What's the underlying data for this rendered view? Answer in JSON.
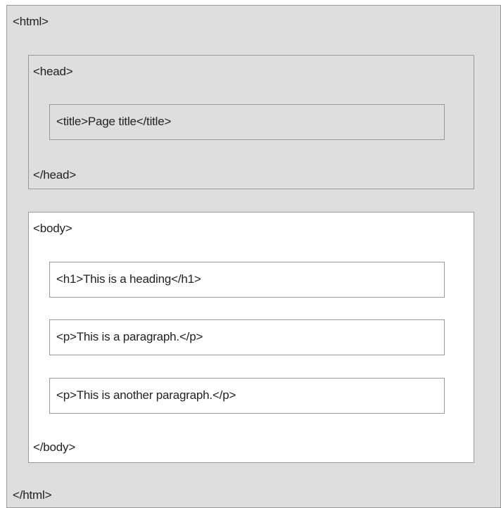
{
  "html": {
    "open_tag": "<html>",
    "close_tag": "</html>",
    "head": {
      "open_tag": "<head>",
      "close_tag": "</head>",
      "title_element": "<title>Page title</title>"
    },
    "body": {
      "open_tag": "<body>",
      "close_tag": "</body>",
      "children": [
        "<h1>This is a heading</h1>",
        "<p>This is a paragraph.</p>",
        "<p>This is another paragraph.</p>"
      ]
    }
  },
  "colors": {
    "head_background": "#dedede",
    "body_background": "#ffffff",
    "border": "#999999",
    "text": "#222222"
  }
}
